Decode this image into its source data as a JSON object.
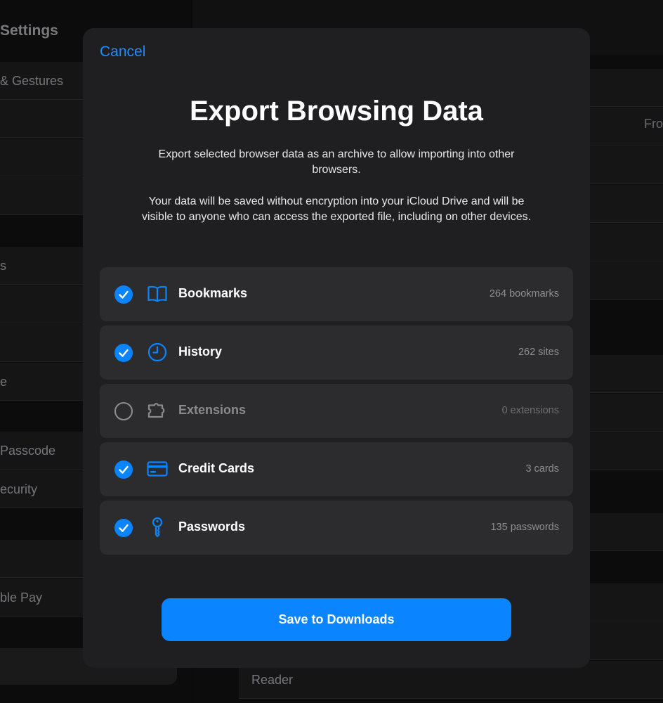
{
  "background": {
    "left_title": "Settings",
    "left_rows": [
      "& Gestures",
      "",
      "",
      "",
      "s",
      "",
      "",
      "e",
      "Passcode",
      "ecurity",
      "",
      "ble Pay"
    ],
    "right_from_text": "Fro",
    "right_reader": "Reader"
  },
  "modal": {
    "cancel_label": "Cancel",
    "title": "Export Browsing Data",
    "description_1": "Export selected browser data as an archive to allow importing into other browsers.",
    "description_2": "Your data will be saved without encryption into your iCloud Drive and will be visible to anyone who can access the exported file, including on other devices.",
    "options": [
      {
        "label": "Bookmarks",
        "count": "264 bookmarks",
        "checked": true,
        "icon": "book-icon"
      },
      {
        "label": "History",
        "count": "262 sites",
        "checked": true,
        "icon": "clock-icon"
      },
      {
        "label": "Extensions",
        "count": "0 extensions",
        "checked": false,
        "icon": "puzzle-icon"
      },
      {
        "label": "Credit Cards",
        "count": "3 cards",
        "checked": true,
        "icon": "credit-card-icon"
      },
      {
        "label": "Passwords",
        "count": "135 passwords",
        "checked": true,
        "icon": "key-icon"
      }
    ],
    "save_label": "Save to Downloads"
  },
  "colors": {
    "accent": "#0a84ff",
    "modal_bg": "#1f1f21",
    "row_bg": "#2c2c2e"
  }
}
